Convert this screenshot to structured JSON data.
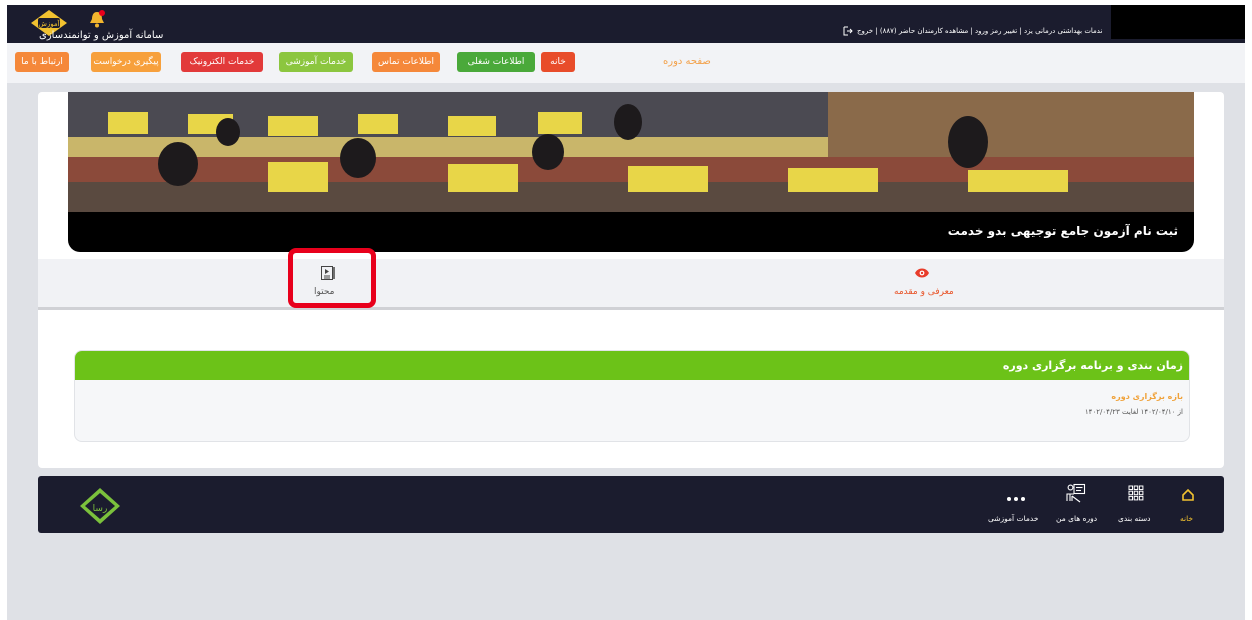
{
  "header": {
    "app_title": "سامانه آموزش و توانمندسازی",
    "user_links": "ندمات بهداشتی درمانی یزد | تغییر رمز ورود | مشاهده کارمندان حاضر (۸۸۷) | خروج",
    "logo_text": "آموزش"
  },
  "nav": {
    "items": [
      {
        "label": "ارتباط با ما",
        "color": "#f5883a"
      },
      {
        "label": "پیگیری درخواست",
        "color": "#f7a03c"
      },
      {
        "label": "خدمات الکترونیک",
        "color": "#e23a3a"
      },
      {
        "label": "خدمات آموزشی",
        "color": "#8cc63f"
      },
      {
        "label": "اطلاعات تماس",
        "color": "#f5883a"
      },
      {
        "label": "اطلاعات شغلی",
        "color": "#4aa93a"
      },
      {
        "label": "خانه",
        "color": "#e84c2a"
      }
    ],
    "breadcrumb": "صفحه دوره"
  },
  "course": {
    "title": "ثبت نام آزمون جامع توجیهی بدو خدمت",
    "tabs": {
      "content": "محتوا",
      "intro": "معرفی و مقدمه"
    },
    "schedule": {
      "title": "زمان بندی و برنامه برگزاری دوره",
      "period_label": "بازه برگزاری دوره",
      "period_range": "از ۱۴۰۲/۰۴/۱۰ لغایت ۱۴۰۲/۰۴/۲۳"
    }
  },
  "footer": {
    "home": "خانه",
    "categories": "دسته بندی",
    "my_courses": "دوره های من",
    "edu_services": "خدمات آموزشی",
    "logo_text": "رسا"
  },
  "colors": {
    "dark": "#1b1c2e",
    "accent_green": "#6cc218",
    "accent_orange": "#f0a23a",
    "highlight_red": "#e8001c"
  }
}
